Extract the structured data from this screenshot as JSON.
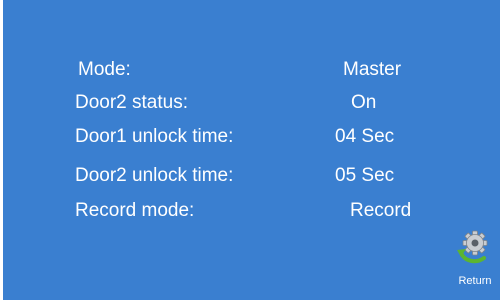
{
  "settings": [
    {
      "label": "Mode:",
      "value": "Master"
    },
    {
      "label": "Door2 status:",
      "value": "On"
    },
    {
      "label": "Door1 unlock time:",
      "value": "04 Sec"
    },
    {
      "label": "Door2 unlock time:",
      "value": "05 Sec"
    },
    {
      "label": "Record mode:",
      "value": "Record"
    }
  ],
  "footer": {
    "return_label": "Return",
    "return_icon": "gear-return-icon"
  },
  "colors": {
    "background": "#3a7fd0",
    "text": "#ffffff",
    "icon_gear": "#c9cdd2",
    "icon_arrow": "#5cb531"
  }
}
